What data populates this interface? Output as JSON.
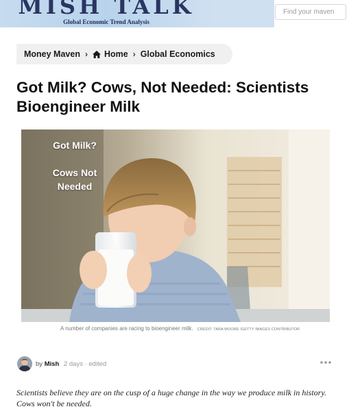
{
  "header": {
    "logo_title": "MISH TALK",
    "logo_subtitle": "Global Economic Trend Analysis",
    "search_placeholder": "Find your maven"
  },
  "breadcrumb": {
    "items": [
      "Money Maven",
      "Home",
      "Global Economics"
    ]
  },
  "article": {
    "title": "Got Milk? Cows, Not Needed: Scientists Bioengineer Milk",
    "hero": {
      "overlay_line1": "Got Milk?",
      "overlay_line2": "Cows Not Needed"
    },
    "caption": "A number of companies are racing to bioengineer milk.",
    "caption_credit": "CREDIT: TARA MOORE /GETTY IMAGES CONTRIBUTOR",
    "author": {
      "prefix": "by",
      "name": "Mish",
      "meta": "2 days · edited"
    },
    "lead": "Scientists believe they are on the cusp of a huge change in the way we produce milk in history. Cows won't be needed."
  },
  "icons": {
    "home": "home-icon",
    "more": "more-options-icon"
  }
}
